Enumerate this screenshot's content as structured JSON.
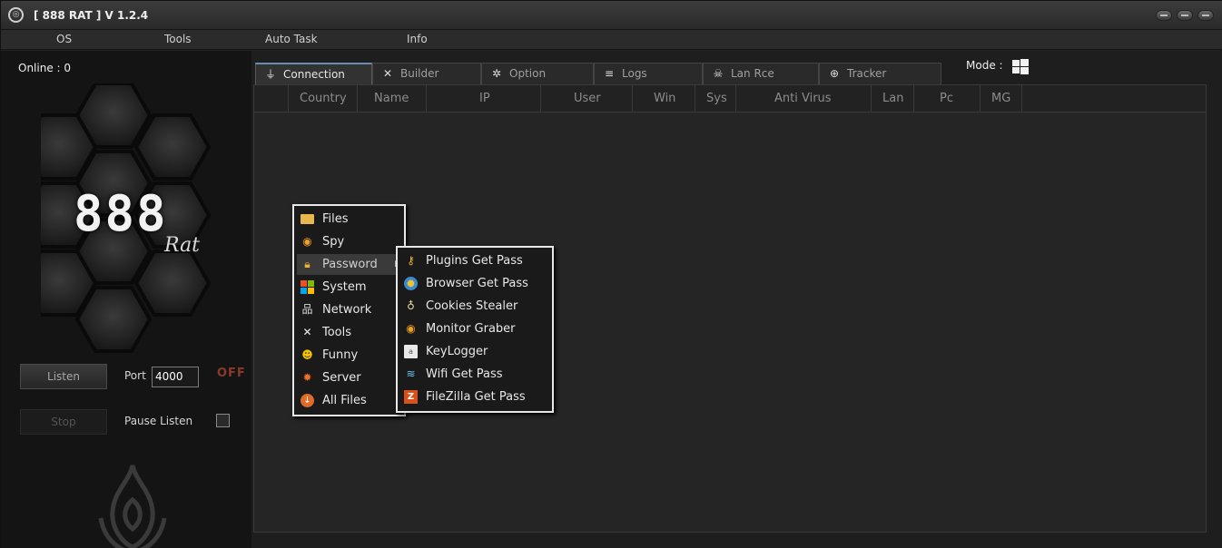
{
  "window": {
    "title": "[ 888 RAT ] V 1.2.4"
  },
  "menu": {
    "items": [
      "OS",
      "Tools",
      "Auto Task",
      "Info"
    ]
  },
  "sidebar": {
    "online_label": "Online : 0",
    "logo_number": "888",
    "logo_text": "Rat",
    "listen_button": "Listen",
    "stop_button": "Stop",
    "port_label": "Port",
    "port_value": "4000",
    "status": "OFF",
    "pause_label": "Pause Listen"
  },
  "mode_label": "Mode :",
  "tabs": [
    {
      "label": "Connection",
      "icon": "plug-icon",
      "active": true
    },
    {
      "label": "Builder",
      "icon": "tools-icon"
    },
    {
      "label": "Option",
      "icon": "gear-icon"
    },
    {
      "label": "Logs",
      "icon": "database-icon"
    },
    {
      "label": "Lan Rce",
      "icon": "skull-icon"
    },
    {
      "label": "Tracker",
      "icon": "globe-icon"
    }
  ],
  "columns": [
    "Country",
    "Name",
    "IP",
    "User",
    "Win",
    "Sys",
    "Anti Virus",
    "Lan",
    "Pc",
    "MG"
  ],
  "context_menu": {
    "items": [
      {
        "label": "Files",
        "icon": "folder-icon"
      },
      {
        "label": "Spy",
        "icon": "eye-icon"
      },
      {
        "label": "Password",
        "icon": "lock-icon",
        "highlighted": true,
        "submenu": true
      },
      {
        "label": "System",
        "icon": "windows-icon"
      },
      {
        "label": "Network",
        "icon": "network-icon"
      },
      {
        "label": "Tools",
        "icon": "tools-icon"
      },
      {
        "label": "Funny",
        "icon": "smiley-icon"
      },
      {
        "label": "Server",
        "icon": "sun-icon"
      },
      {
        "label": "All Files",
        "icon": "download-icon"
      }
    ],
    "submenu": [
      {
        "label": "Plugins Get Pass",
        "icon": "key-icon"
      },
      {
        "label": "Browser Get Pass",
        "icon": "globe-icon"
      },
      {
        "label": "Cookies Stealer",
        "icon": "bag-icon"
      },
      {
        "label": "Monitor Graber",
        "icon": "eye-icon"
      },
      {
        "label": "KeyLogger",
        "icon": "keyboard-icon"
      },
      {
        "label": "Wifi Get Pass",
        "icon": "wifi-icon"
      },
      {
        "label": "FileZilla Get Pass",
        "icon": "filezilla-icon"
      }
    ]
  },
  "colors": {
    "accent": "#6b8cb0",
    "status_off": "#8b3a26"
  }
}
